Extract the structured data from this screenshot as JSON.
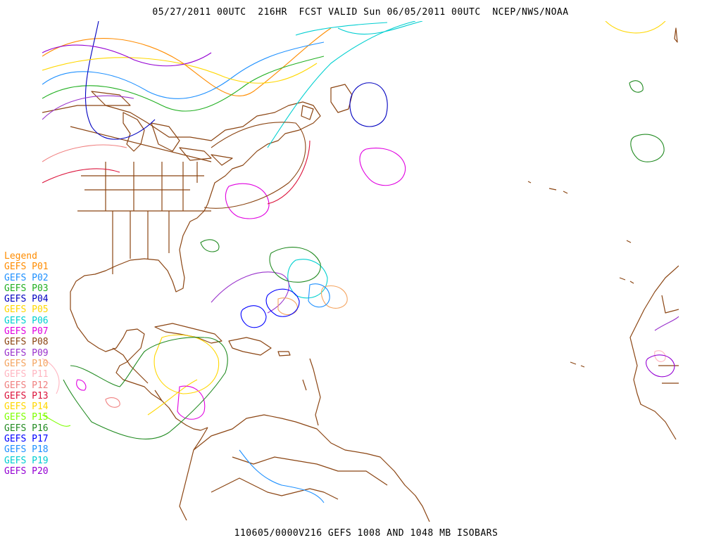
{
  "header": {
    "title": "05/27/2011 00UTC  216HR  FCST VALID Sun 06/05/2011 00UTC  NCEP/NWS/NOAA"
  },
  "footer": {
    "caption": "110605/0000V216 GEFS 1008 AND 1048 MB ISOBARS"
  },
  "colors": {
    "background": "#ffffff",
    "coastline": "#8b4513"
  },
  "legend": {
    "title": "Legend",
    "title_color": "#ff8c00",
    "items": [
      {
        "label": "GEFS P01",
        "color": "#ff8c00"
      },
      {
        "label": "GEFS P02",
        "color": "#1e90ff"
      },
      {
        "label": "GEFS P03",
        "color": "#22b022"
      },
      {
        "label": "GEFS P04",
        "color": "#0000c0"
      },
      {
        "label": "GEFS P05",
        "color": "#ffd700"
      },
      {
        "label": "GEFS P06",
        "color": "#00d0d0"
      },
      {
        "label": "GEFS P07",
        "color": "#e000e0"
      },
      {
        "label": "GEFS P08",
        "color": "#8b4513"
      },
      {
        "label": "GEFS P09",
        "color": "#9932cc"
      },
      {
        "label": "GEFS P10",
        "color": "#f4a460"
      },
      {
        "label": "GEFS P11",
        "color": "#ffb6c1"
      },
      {
        "label": "GEFS P12",
        "color": "#f08080"
      },
      {
        "label": "GEFS P13",
        "color": "#dc143c"
      },
      {
        "label": "GEFS P14",
        "color": "#ffd700"
      },
      {
        "label": "GEFS P15",
        "color": "#7fff00"
      },
      {
        "label": "GEFS P16",
        "color": "#228b22"
      },
      {
        "label": "GEFS P17",
        "color": "#0000ff"
      },
      {
        "label": "GEFS P18",
        "color": "#1e90ff"
      },
      {
        "label": "GEFS P19",
        "color": "#00ced1"
      },
      {
        "label": "GEFS P20",
        "color": "#9400d3"
      }
    ]
  }
}
